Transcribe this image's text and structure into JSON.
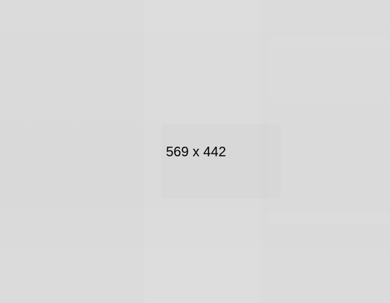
{
  "placeholder": {
    "label": "569 x 442",
    "background_color": "#dadada",
    "text_color": "#000000"
  }
}
